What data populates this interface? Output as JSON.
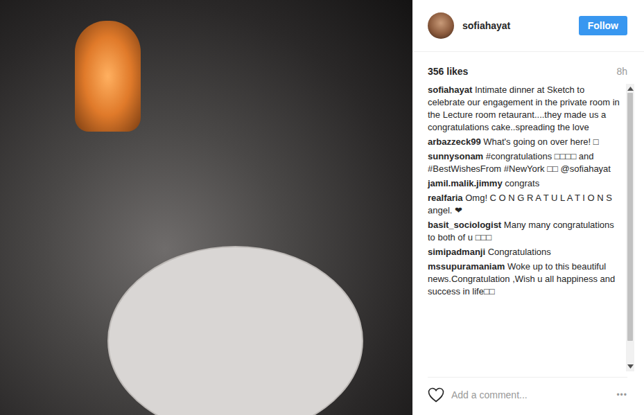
{
  "post": {
    "username": "sofiahayat",
    "follow_button": "Follow",
    "likes": "356 likes",
    "time": "8h",
    "liked": false,
    "caption": {
      "username": "sofiahayat",
      "text": "Intimate dinner at Sketch to celebrate our engagement in the private room in the Lecture room retaurant....they made us a congratulations cake..spreading the love"
    },
    "comments": [
      {
        "username": "arbazzeck99",
        "text": "What's going on over here! □"
      },
      {
        "username": "sunnysonam",
        "text": "#congratulations □□□□ and #BestWishesFrom #NewYork □□ @sofiahayat"
      },
      {
        "username": "jamil.malik.jimmy",
        "text": "congrats"
      },
      {
        "username": "realfaria",
        "text": "Omg! C O N G R A T U L A T I O N S angel. ❤"
      },
      {
        "username": "basit_sociologist",
        "text": "Many many congratulations to both of u □□□"
      },
      {
        "username": "simipadmanji",
        "text": "Congratulations"
      },
      {
        "username": "mssupuramaniam",
        "text": "Woke up to this beautiful news.Congratulation ,Wish u all happiness and success in life□□"
      }
    ],
    "add_comment_placeholder": "Add a comment...",
    "more_button": "•••"
  }
}
